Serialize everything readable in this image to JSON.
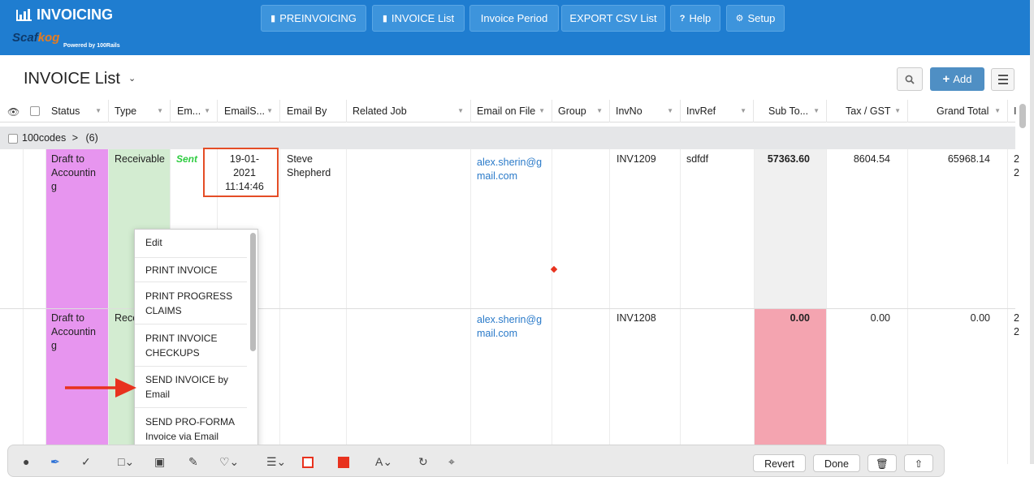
{
  "app": {
    "title": "INVOICING",
    "logo_text_a": "Scaf",
    "logo_text_b": "kog",
    "powered_by": "Powered by 100Rails"
  },
  "nav": {
    "items": [
      {
        "label": "PREINVOICING",
        "icon": "book-icon"
      },
      {
        "label": "INVOICE List",
        "icon": "book-icon"
      },
      {
        "label": "Invoice Period",
        "icon": ""
      },
      {
        "label": "EXPORT CSV List",
        "icon": ""
      },
      {
        "label": "Help",
        "icon": "question-icon"
      },
      {
        "label": "Setup",
        "icon": "gear-icon"
      }
    ]
  },
  "page": {
    "title": "INVOICE List",
    "add_label": "Add"
  },
  "table": {
    "columns": [
      "Status",
      "Type",
      "Em...",
      "EmailS...",
      "Email By",
      "Related Job",
      "Email on File",
      "Group",
      "InvNo",
      "InvRef",
      "Sub To...",
      "Tax / GST",
      "Grand Total",
      "I"
    ],
    "group": {
      "name": "100codes",
      "caret": ">",
      "count": "(6)"
    },
    "rows": [
      {
        "status": [
          "Draft to",
          "Accountin",
          "g"
        ],
        "type": "Receivable",
        "email_status": "Sent",
        "email_sent": [
          "19-01-",
          "2021",
          "11:14:46"
        ],
        "email_by": [
          "Steve",
          "Shepherd"
        ],
        "email_on_file": [
          "alex.sherin@g",
          "mail.com"
        ],
        "inv_no": "INV1209",
        "inv_ref": "sdfdf",
        "sub_total": "57363.60",
        "tax": "8604.54",
        "grand_total": "65968.14",
        "trail": [
          "2",
          "2"
        ]
      },
      {
        "status": [
          "Draft to",
          "Accountin",
          "g"
        ],
        "type": "Rece",
        "email_on_file": [
          "alex.sherin@g",
          "mail.com"
        ],
        "inv_no": "INV1208",
        "sub_total": "0.00",
        "tax": "0.00",
        "grand_total": "0.00",
        "trail": [
          "2",
          "2"
        ]
      }
    ]
  },
  "context_menu": {
    "items": [
      [
        "Edit"
      ],
      [
        "PRINT INVOICE"
      ],
      [
        "PRINT PROGRESS",
        "CLAIMS"
      ],
      [
        "PRINT INVOICE",
        "CHECKUPS"
      ],
      [
        "SEND INVOICE by",
        "Email"
      ],
      [
        "SEND PRO-FORMA",
        "Invoice via Email"
      ]
    ]
  },
  "markup_toolbar": {
    "revert_label": "Revert",
    "done_label": "Done"
  },
  "colors": {
    "topbar": "#1f7dd0",
    "status_draft": "#e795ef",
    "type_receivable": "#d3ecd1",
    "subtotal_zero": "#f4a4b0",
    "annotation_red": "#e44d26"
  }
}
